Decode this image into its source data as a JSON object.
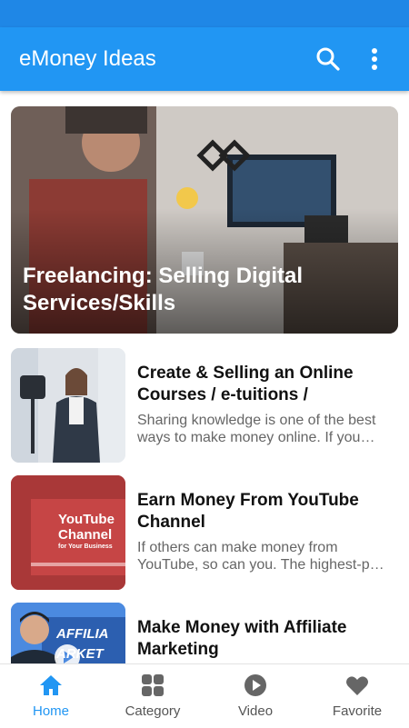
{
  "app": {
    "title": "eMoney Ideas",
    "accent": "#2196f3"
  },
  "hero": {
    "title": "Freelancing: Selling Digital Services/Skills"
  },
  "articles": [
    {
      "title": "Create & Selling an Online Courses / e-tuitions /",
      "description": "Sharing knowledge is one of the best ways to make money online. If you have expertise..."
    },
    {
      "title": "Earn Money From YouTube Channel",
      "description": "If others can make money from YouTube, so can you. The highest-paid YouTubers..."
    },
    {
      "title": "Make Money with Affiliate Marketing",
      "description": ""
    }
  ],
  "thumbs": {
    "youtube_text_1": "YouTube",
    "youtube_text_2": "Channel",
    "youtube_text_3": "for Your Business",
    "affiliate_text_1": "AFFILIA",
    "affiliate_text_2": "ARKET"
  },
  "nav": [
    {
      "label": "Home",
      "icon": "home-icon",
      "active": true
    },
    {
      "label": "Category",
      "icon": "grid-icon",
      "active": false
    },
    {
      "label": "Video",
      "icon": "play-circle-icon",
      "active": false
    },
    {
      "label": "Favorite",
      "icon": "heart-icon",
      "active": false
    }
  ]
}
